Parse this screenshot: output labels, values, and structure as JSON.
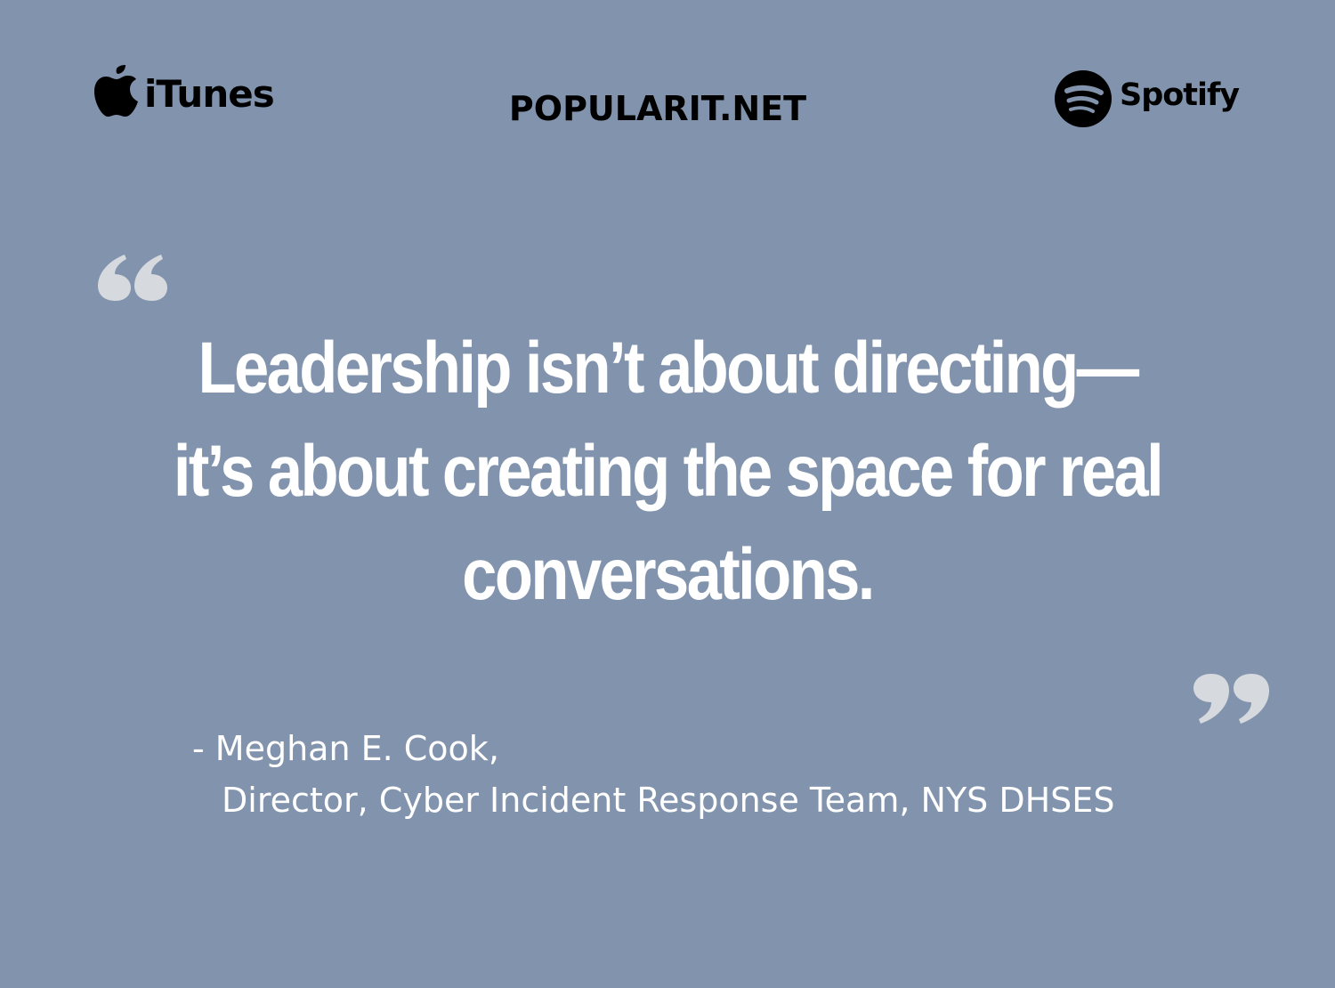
{
  "header": {
    "itunes_label": "iTunes",
    "site_name": "POPULARIT.NET",
    "spotify_label": "Spotify"
  },
  "icons": {
    "itunes": "apple-icon",
    "spotify": "spotify-icon",
    "quote_open": "open-quote-icon",
    "quote_close": "close-quote-icon"
  },
  "quote": {
    "text": "Leadership isn’t about directing—it’s about creating the space for real conversations."
  },
  "attribution": {
    "name_line": "- Meghan E. Cook,",
    "title_line": "Director, Cyber Incident Response Team, NYS DHSES"
  },
  "colors": {
    "background": "#8294ad",
    "quote_text": "#ffffff",
    "quote_marks": "#d6d9dd",
    "logo": "#000000"
  }
}
